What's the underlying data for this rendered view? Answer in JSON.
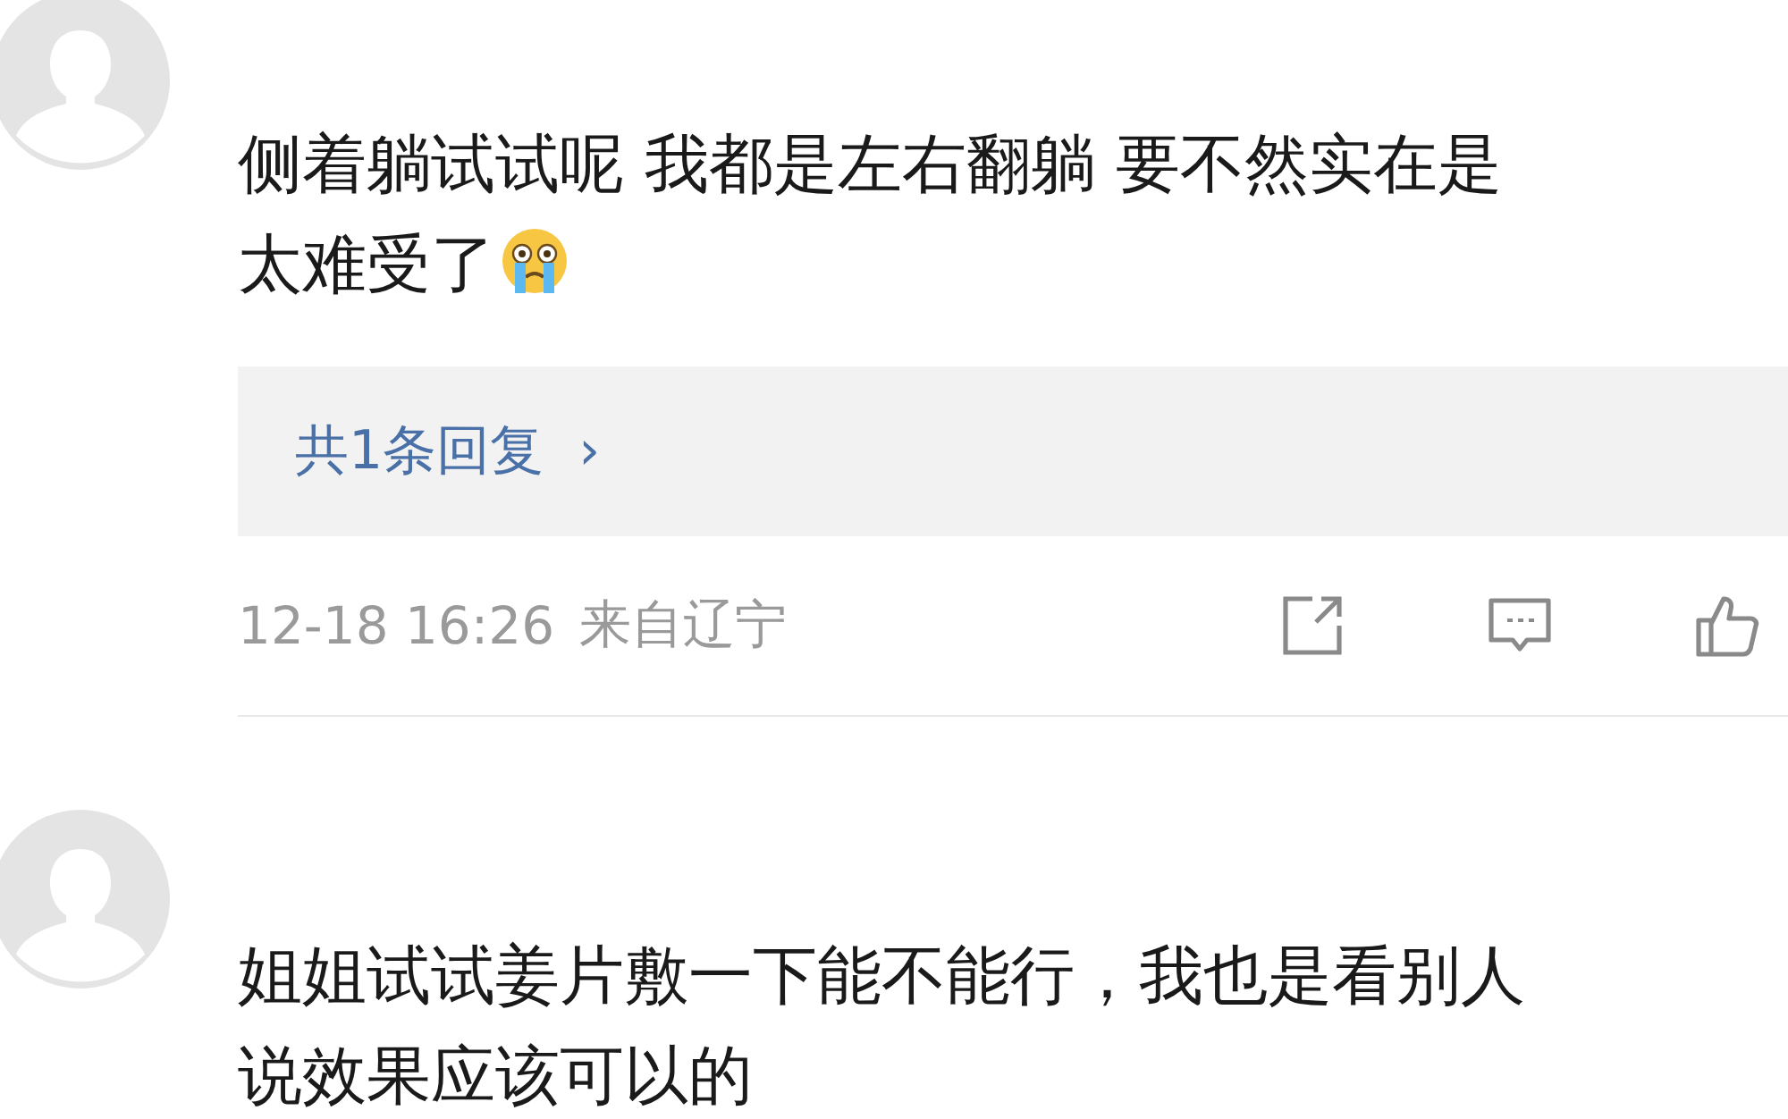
{
  "comments": [
    {
      "lines": [
        "侧着躺试试呢 我都是左右翻躺 要不然实在是",
        "太难受了"
      ],
      "emoji": true,
      "replies": {
        "label": "共1条回复",
        "chevron": "›"
      },
      "time": "12-18 16:26",
      "location": "来自辽宁"
    },
    {
      "lines": [
        "姐姐试试姜片敷一下能不能行，我也是看别人",
        "说效果应该可以的"
      ]
    }
  ]
}
